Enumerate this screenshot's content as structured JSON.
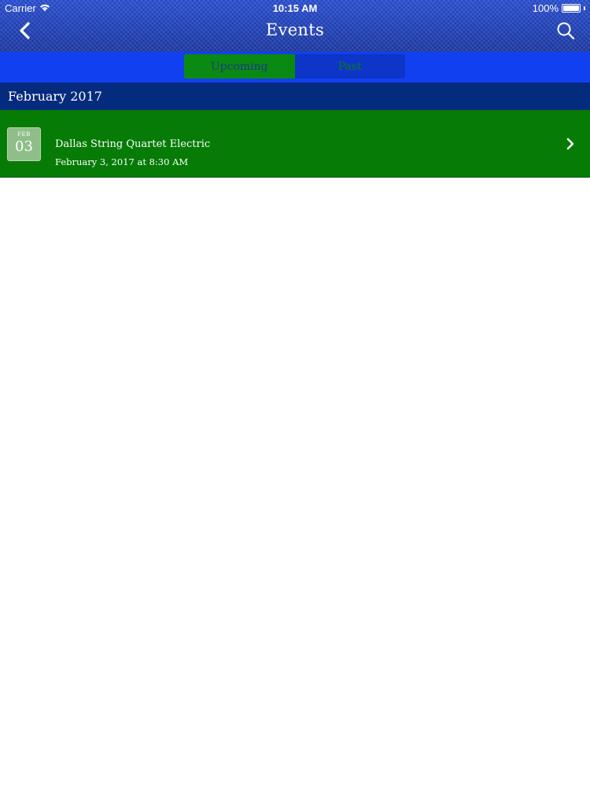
{
  "status_bar": {
    "carrier": "Carrier",
    "time": "10:15 AM",
    "battery": "100%",
    "icons": [
      "wifi-icon",
      "battery-icon"
    ]
  },
  "nav": {
    "title": "Events",
    "back_icon": "chevron-left-icon",
    "search_icon": "search-icon"
  },
  "segments": {
    "items": [
      {
        "label": "Upcoming",
        "selected": true
      },
      {
        "label": "Past",
        "selected": false
      }
    ]
  },
  "sections": [
    {
      "header": "February 2017",
      "events": [
        {
          "month": "FEB",
          "day": "03",
          "title": "Dallas String Quartet Electric",
          "datetime": "February 3, 2017 at 8:30 AM",
          "icon": "chevron-right-icon"
        }
      ]
    }
  ],
  "colors": {
    "nav_bar": "#1f3fbf",
    "segment_strip": "#1140f0",
    "segment_active": "#0a8a12",
    "segment_inactive": "#0d36c8",
    "section_header": "#052b7e",
    "event_row": "#067b06",
    "background": "#ffffff"
  }
}
